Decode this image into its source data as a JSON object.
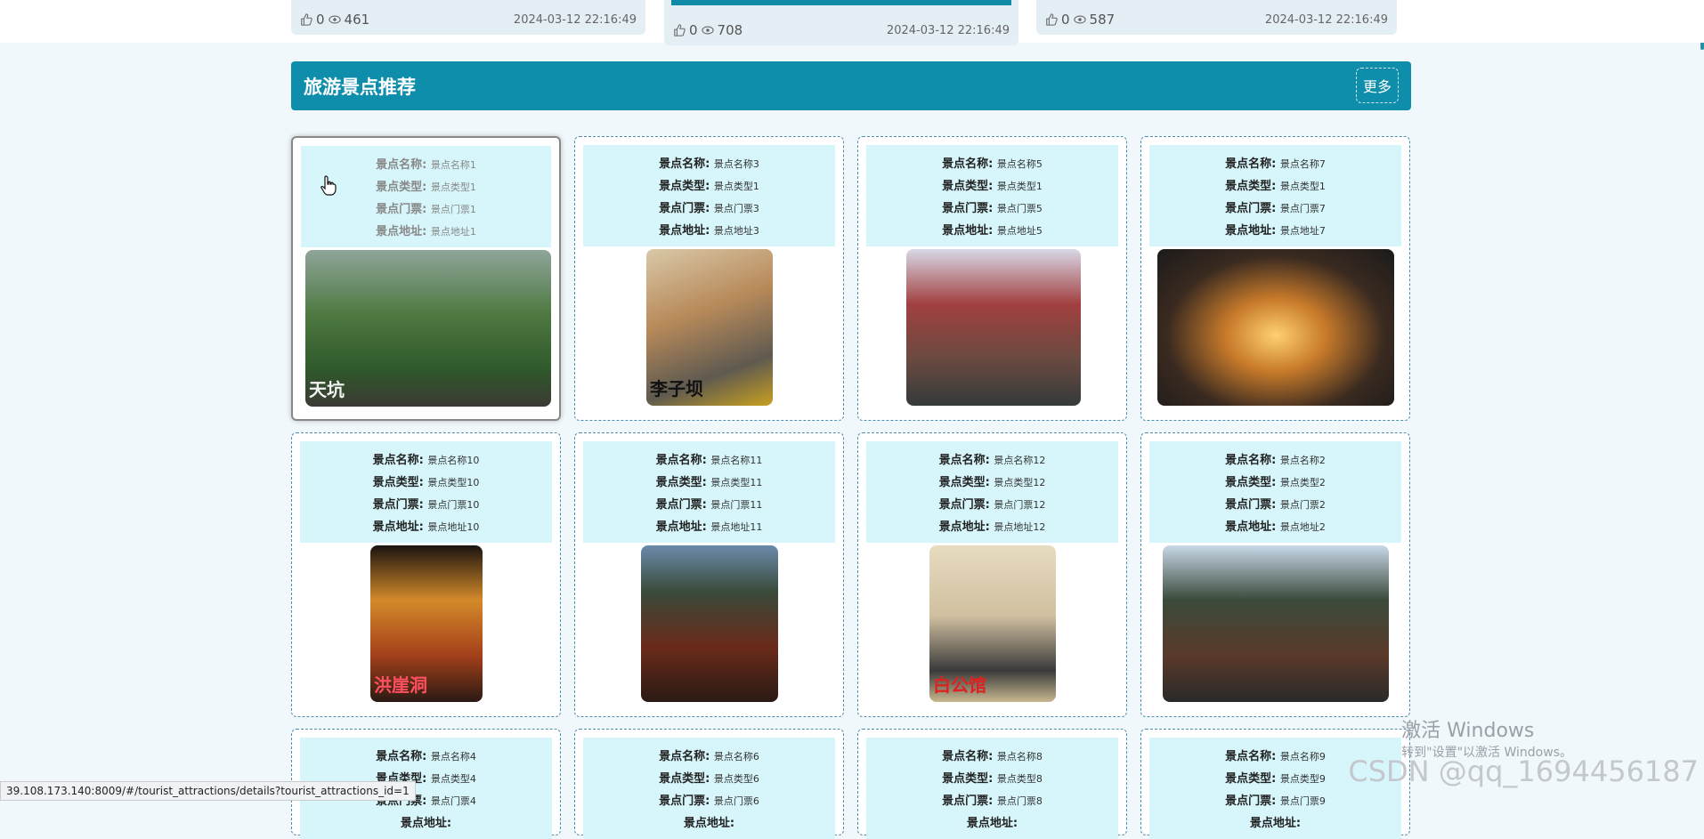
{
  "top_cards": [
    {
      "likes": "0",
      "views": "461",
      "time": "2024-03-12 22:16:49"
    },
    {
      "likes": "0",
      "views": "708",
      "time": "2024-03-12 22:16:49"
    },
    {
      "likes": "0",
      "views": "587",
      "time": "2024-03-12 22:16:49"
    }
  ],
  "section": {
    "title": "旅游景点推荐",
    "more": "更多"
  },
  "labels": {
    "name": "景点名称:",
    "type": "景点类型:",
    "ticket": "景点门票:",
    "address": "景点地址:"
  },
  "attractions": [
    {
      "name": "景点名称1",
      "type": "景点类型1",
      "ticket": "景点门票1",
      "address": "景点地址1",
      "caption": "天坑"
    },
    {
      "name": "景点名称3",
      "type": "景点类型1",
      "ticket": "景点门票3",
      "address": "景点地址3",
      "caption": "李子坝"
    },
    {
      "name": "景点名称5",
      "type": "景点类型1",
      "ticket": "景点门票5",
      "address": "景点地址5",
      "caption": ""
    },
    {
      "name": "景点名称7",
      "type": "景点类型1",
      "ticket": "景点门票7",
      "address": "景点地址7",
      "caption": ""
    },
    {
      "name": "景点名称10",
      "type": "景点类型10",
      "ticket": "景点门票10",
      "address": "景点地址10",
      "caption": "洪崖洞"
    },
    {
      "name": "景点名称11",
      "type": "景点类型11",
      "ticket": "景点门票11",
      "address": "景点地址11",
      "caption": ""
    },
    {
      "name": "景点名称12",
      "type": "景点类型12",
      "ticket": "景点门票12",
      "address": "景点地址12",
      "caption": "白公馆"
    },
    {
      "name": "景点名称2",
      "type": "景点类型2",
      "ticket": "景点门票2",
      "address": "景点地址2",
      "caption": ""
    },
    {
      "name": "景点名称4",
      "type": "景点类型4",
      "ticket": "景点门票4",
      "address": "",
      "caption": ""
    },
    {
      "name": "景点名称6",
      "type": "景点类型6",
      "ticket": "景点门票6",
      "address": "",
      "caption": ""
    },
    {
      "name": "景点名称8",
      "type": "景点类型8",
      "ticket": "景点门票8",
      "address": "",
      "caption": ""
    },
    {
      "name": "景点名称9",
      "type": "景点类型9",
      "ticket": "景点门票9",
      "address": "",
      "caption": ""
    }
  ],
  "status_url": "39.108.173.140:8009/#/tourist_attractions/details?tourist_attractions_id=1",
  "watermark": {
    "line1": "激活 Windows",
    "line2": "转到\"设置\"以激活 Windows。"
  },
  "csdn": "CSDN @qq_1694456187",
  "colors": {
    "accent": "#0f8eab",
    "info_bg": "#d6f6fb",
    "page_bg": "#f0f8fc"
  }
}
